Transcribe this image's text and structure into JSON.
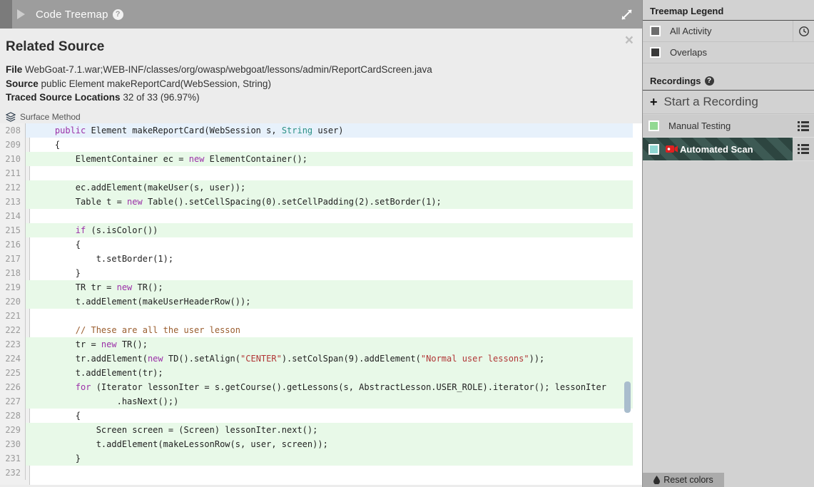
{
  "topbar": {
    "title": "Code Treemap",
    "help": "?"
  },
  "panel": {
    "title": "Related Source",
    "close": "×",
    "file_label": "File",
    "file_value": "WebGoat-7.1.war;WEB-INF/classes/org/owasp/webgoat/lessons/admin/ReportCardScreen.java",
    "source_label": "Source",
    "source_value": "public Element makeReportCard(WebSession, String)",
    "traced_label": "Traced Source Locations",
    "traced_value": "32 of 33 (96.97%)",
    "surface_method": "Surface Method"
  },
  "code": {
    "lines": [
      {
        "num": "208",
        "bg": "blue",
        "segs": [
          [
            "plain",
            "    "
          ],
          [
            "kw",
            "public"
          ],
          [
            "plain",
            " Element makeReportCard(WebSession s, "
          ],
          [
            "typ",
            "String"
          ],
          [
            "plain",
            " user)"
          ]
        ]
      },
      {
        "num": "209",
        "bg": "none",
        "segs": [
          [
            "plain",
            "    {"
          ]
        ]
      },
      {
        "num": "210",
        "bg": "green",
        "segs": [
          [
            "plain",
            "        ElementContainer ec = "
          ],
          [
            "kw",
            "new"
          ],
          [
            "plain",
            " ElementContainer();"
          ]
        ]
      },
      {
        "num": "211",
        "bg": "none",
        "segs": []
      },
      {
        "num": "212",
        "bg": "green",
        "segs": [
          [
            "plain",
            "        ec.addElement(makeUser(s, user));"
          ]
        ]
      },
      {
        "num": "213",
        "bg": "green",
        "segs": [
          [
            "plain",
            "        Table t = "
          ],
          [
            "kw",
            "new"
          ],
          [
            "plain",
            " Table().setCellSpacing(0).setCellPadding(2).setBorder(1);"
          ]
        ]
      },
      {
        "num": "214",
        "bg": "none",
        "segs": []
      },
      {
        "num": "215",
        "bg": "green",
        "segs": [
          [
            "plain",
            "        "
          ],
          [
            "kw",
            "if"
          ],
          [
            "plain",
            " (s.isColor())"
          ]
        ]
      },
      {
        "num": "216",
        "bg": "none",
        "segs": [
          [
            "plain",
            "        {"
          ]
        ]
      },
      {
        "num": "217",
        "bg": "none",
        "segs": [
          [
            "plain",
            "            t.setBorder(1);"
          ]
        ]
      },
      {
        "num": "218",
        "bg": "none",
        "segs": [
          [
            "plain",
            "        }"
          ]
        ]
      },
      {
        "num": "219",
        "bg": "green",
        "segs": [
          [
            "plain",
            "        TR tr = "
          ],
          [
            "kw",
            "new"
          ],
          [
            "plain",
            " TR();"
          ]
        ]
      },
      {
        "num": "220",
        "bg": "green",
        "segs": [
          [
            "plain",
            "        t.addElement(makeUserHeaderRow());"
          ]
        ]
      },
      {
        "num": "221",
        "bg": "none",
        "segs": []
      },
      {
        "num": "222",
        "bg": "none",
        "segs": [
          [
            "com",
            "        // These are all the user lesson"
          ]
        ]
      },
      {
        "num": "223",
        "bg": "green",
        "segs": [
          [
            "plain",
            "        tr = "
          ],
          [
            "kw",
            "new"
          ],
          [
            "plain",
            " TR();"
          ]
        ]
      },
      {
        "num": "224",
        "bg": "green",
        "segs": [
          [
            "plain",
            "        tr.addElement("
          ],
          [
            "kw",
            "new"
          ],
          [
            "plain",
            " TD().setAlign("
          ],
          [
            "str",
            "\"CENTER\""
          ],
          [
            "plain",
            ").setColSpan(9).addElement("
          ],
          [
            "str",
            "\"Normal user lessons\""
          ],
          [
            "plain",
            "));"
          ]
        ]
      },
      {
        "num": "225",
        "bg": "green",
        "segs": [
          [
            "plain",
            "        t.addElement(tr);"
          ]
        ]
      },
      {
        "num": "226",
        "bg": "green",
        "segs": [
          [
            "plain",
            "        "
          ],
          [
            "kw",
            "for"
          ],
          [
            "plain",
            " (Iterator lessonIter = s.getCourse().getLessons(s, AbstractLesson.USER_ROLE).iterator(); lessonIter"
          ]
        ]
      },
      {
        "num": "227",
        "bg": "green",
        "segs": [
          [
            "plain",
            "                .hasNext();)"
          ]
        ]
      },
      {
        "num": "228",
        "bg": "none",
        "segs": [
          [
            "plain",
            "        {"
          ]
        ]
      },
      {
        "num": "229",
        "bg": "green",
        "segs": [
          [
            "plain",
            "            Screen screen = (Screen) lessonIter.next();"
          ]
        ]
      },
      {
        "num": "230",
        "bg": "green",
        "segs": [
          [
            "plain",
            "            t.addElement(makeLessonRow(s, user, screen));"
          ]
        ]
      },
      {
        "num": "231",
        "bg": "green",
        "segs": [
          [
            "plain",
            "        }"
          ]
        ]
      },
      {
        "num": "232",
        "bg": "none",
        "segs": []
      }
    ]
  },
  "sidebar": {
    "legend": {
      "title": "Treemap Legend",
      "items": [
        {
          "label": "All Activity",
          "swatch": "#6e6e6e"
        },
        {
          "label": "Overlaps",
          "swatch": "#3a3a3a"
        }
      ]
    },
    "recordings": {
      "title": "Recordings",
      "help": "?",
      "start_label": "Start a Recording",
      "plus": "+",
      "items": [
        {
          "label": "Manual Testing",
          "swatch": "#92d992"
        },
        {
          "label": "Automated Scan",
          "swatch": "#8fd7d2"
        }
      ]
    },
    "reset_label": "Reset colors"
  },
  "colors": {
    "selected_row_base": "#3d5a54",
    "selected_row_stripe": "#2d4540",
    "line_highlight_green": "#e8f9e8",
    "line_highlight_blue": "#e7f1fb",
    "keyword": "#9b30a8",
    "type": "#2b9186",
    "comment": "#9a5d2e",
    "string": "#b13636",
    "recording_icon_red": "#e02020"
  }
}
